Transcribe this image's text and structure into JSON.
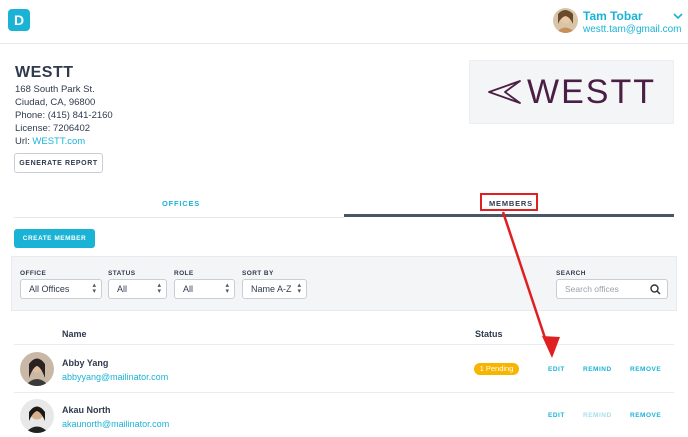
{
  "header": {
    "logo_letter": "D",
    "user_name": "Tam Tobar",
    "user_email": "westt.tam@gmail.com"
  },
  "org": {
    "name": "WESTT",
    "address1": "168 South Park St.",
    "address2": "Ciudad, CA, 96800",
    "phone": "Phone: (415) 841-2160",
    "license": "License: 7206402",
    "url_label": "Url:",
    "url": "WESTT.com",
    "generate_report": "GENERATE REPORT",
    "brand_logo_text": "WESTT"
  },
  "tabs": [
    {
      "label": "OFFICES",
      "active": false
    },
    {
      "label": "MEMBERS",
      "active": true
    }
  ],
  "create_member": "CREATE MEMBER",
  "filters": {
    "office_label": "OFFICE",
    "office_value": "All Offices",
    "status_label": "STATUS",
    "status_value": "All",
    "role_label": "ROLE",
    "role_value": "All",
    "sort_label": "SORT BY",
    "sort_value": "Name A-Z",
    "search_label": "SEARCH",
    "search_placeholder": "Search offices"
  },
  "table": {
    "col_name": "Name",
    "col_status": "Status",
    "rows": [
      {
        "name": "Abby Yang",
        "email": "abbyyang@mailinator.com",
        "status": "1 Pending",
        "edit": "EDIT",
        "remind": "REMIND",
        "remove": "REMOVE"
      },
      {
        "name": "Akau North",
        "email": "akaunorth@mailinator.com",
        "status": "",
        "edit": "EDIT",
        "remind": "REMIND",
        "remove": "REMOVE"
      }
    ]
  },
  "colors": {
    "accent": "#1ab3d6",
    "pending": "#f7b500",
    "annotation": "#e02020",
    "brand": "#4a1f45"
  }
}
